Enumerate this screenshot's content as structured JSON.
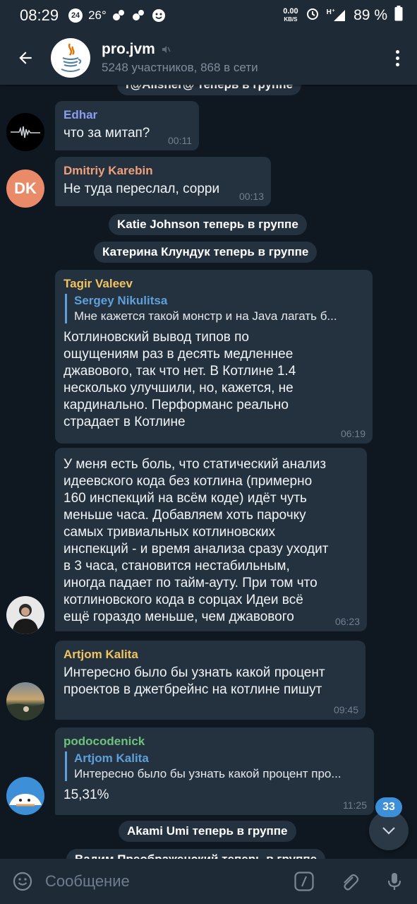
{
  "status_bar": {
    "time": "08:29",
    "notif_count": "24",
    "temperature": "26°",
    "net_speed_value": "0.00",
    "net_speed_unit": "KB/S",
    "network": "H⁺",
    "battery": "89 %"
  },
  "header": {
    "title": "pro.jvm",
    "subtitle": "5248 участников, 868 в сети"
  },
  "messages": {
    "service_top": "r@Allsner@ теперь в группе",
    "m1": {
      "sender": "Edhar",
      "sender_color": "#8b9cf0",
      "text": "что за митап?",
      "time": "00:11"
    },
    "m2": {
      "sender": "Dmitriy Karebin",
      "sender_color": "#f0a07c",
      "avatar_initials": "DK",
      "avatar_color": "#e98b68",
      "text": "Не туда переслал, сорри",
      "time": "00:13"
    },
    "service1": "Katie Johnson теперь в группе",
    "service2": "Катерина Клундук теперь в группе",
    "m3": {
      "sender": "Tagir Valeev",
      "sender_color": "#f2c361",
      "reply_name": "Sergey Nikulitsa",
      "reply_text": "Мне кажется такой монстр и на Java лагать б...",
      "lines": [
        "Котлиновский вывод типов по",
        "ощущениям раз в десять медленнее",
        "джавового, так что нет. В Котлине 1.4",
        "несколько улучшили, но, кажется, не",
        "кардинально. Перформанс реально",
        "страдает в Котлине"
      ],
      "time": "06:19"
    },
    "m4": {
      "lines": [
        "У меня есть боль, что статический анализ",
        "идеевского кода без котлина (примерно",
        "160 инспекций на всём коде) идёт чуть",
        "меньше часа. Добавляем хоть парочку",
        "самых тривиальных котлиновских",
        "инспекций - и время анализа сразу уходит",
        "в 3 часа, становится нестабильным,",
        "иногда падает по тайм-ауту. При том что",
        "котлиновского кода в сорцах Идеи всё",
        "ещё гораздо меньше, чем джавового"
      ],
      "time": "06:23"
    },
    "m5": {
      "sender": "Artjom Kalita",
      "sender_color": "#f2c361",
      "lines": [
        "Интересно было бы узнать какой процент",
        "проектов в джетбрейнс на котлине пишут"
      ],
      "time": "09:45"
    },
    "m6": {
      "sender": "podocodenick",
      "sender_color": "#6cc37c",
      "reply_name": "Artjom Kalita",
      "reply_text": "Интересно было бы узнать какой процент про...",
      "text": "15,31%",
      "time": "11:25"
    },
    "service3": "Akami Umi теперь в группе",
    "service4_partial": "Вадим Преображенский теперь в группе"
  },
  "unread_count": "33",
  "input": {
    "placeholder": "Сообщение"
  }
}
